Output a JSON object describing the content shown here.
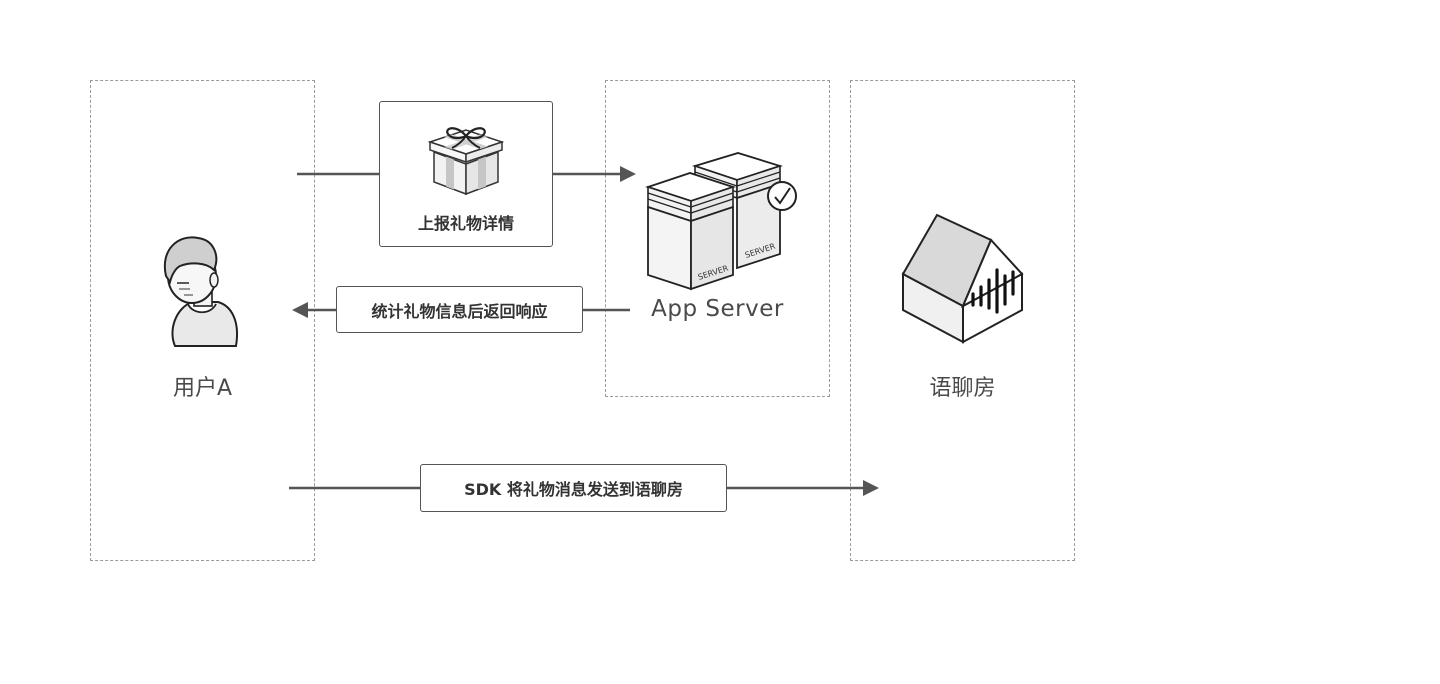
{
  "nodes": {
    "user": {
      "label": "用户A"
    },
    "server": {
      "label": "App Server"
    },
    "room": {
      "label": "语聊房"
    }
  },
  "messages": {
    "report": {
      "label": "上报礼物详情"
    },
    "return": {
      "label": "统计礼物信息后返回响应"
    },
    "sdk": {
      "label": "SDK 将礼物消息发送到语聊房"
    }
  },
  "icons": {
    "user": "person-icon",
    "gift": "gift-box-icon",
    "server": "server-stack-icon",
    "room": "voice-room-house-icon"
  },
  "server_tags": {
    "front": "SERVER",
    "back": "SERVER"
  }
}
